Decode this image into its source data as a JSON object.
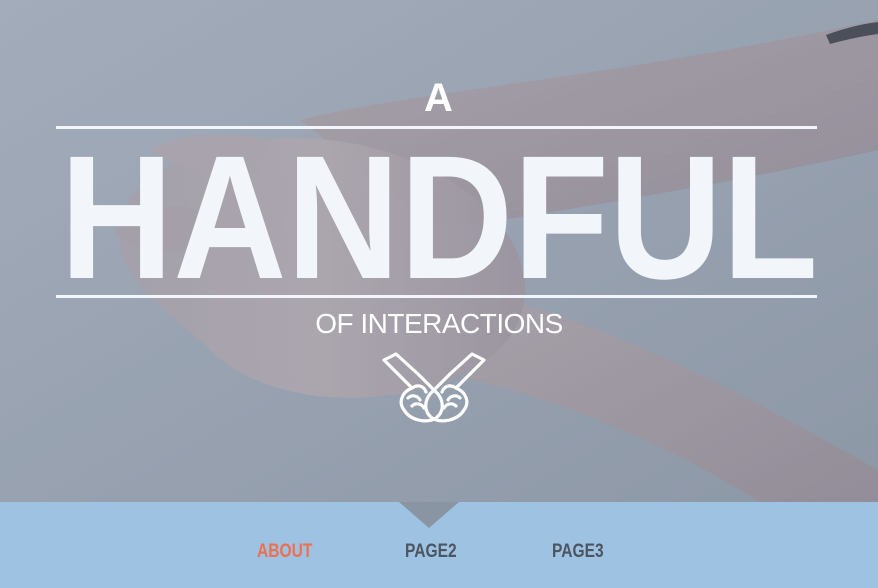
{
  "hero": {
    "title_prefix": "A",
    "title_main": "HANDFUL",
    "title_sub": "OF INTERACTIONS",
    "logo_icon": "crossed-pointing-hands-icon",
    "background_image": "cupped-hands-photo"
  },
  "nav": {
    "items": [
      {
        "label": "ABOUT",
        "active": true
      },
      {
        "label": "PAGE2",
        "active": false
      },
      {
        "label": "PAGE3",
        "active": false
      }
    ]
  },
  "colors": {
    "title_text": "#f2f6fb",
    "navbar_bg": "#9ec2e2",
    "nav_active": "#ef6f4f",
    "nav_inactive": "#4c5662",
    "hero_tint": "#8e96a3"
  }
}
